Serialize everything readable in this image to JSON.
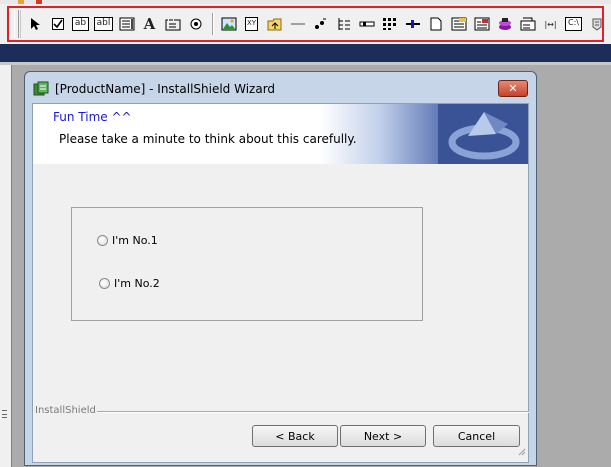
{
  "toolbar": {
    "tools": [
      {
        "id": "select",
        "icon": "arrow-pointer-icon"
      },
      {
        "id": "checkbox",
        "icon": "checkbox-icon"
      },
      {
        "id": "edit",
        "icon": "edit-field-icon",
        "text": "ab"
      },
      {
        "id": "combo",
        "icon": "combo-box-icon",
        "text": "abl"
      },
      {
        "id": "listbox",
        "icon": "list-box-icon"
      },
      {
        "id": "text",
        "icon": "static-text-icon",
        "text": "A"
      },
      {
        "id": "group",
        "icon": "group-box-icon"
      },
      {
        "id": "radio",
        "icon": "radio-group-icon"
      },
      {
        "id": "image",
        "icon": "picture-icon"
      },
      {
        "id": "masked",
        "icon": "masked-edit-icon",
        "text": "XY"
      },
      {
        "id": "folder",
        "icon": "folder-icon"
      },
      {
        "id": "line",
        "icon": "line-icon"
      },
      {
        "id": "progress",
        "icon": "progress-icon"
      },
      {
        "id": "tree",
        "icon": "tree-view-icon"
      },
      {
        "id": "scroll",
        "icon": "scrollbar-icon"
      },
      {
        "id": "dots",
        "icon": "grid-dots-icon"
      },
      {
        "id": "slider",
        "icon": "spin-box-icon"
      },
      {
        "id": "doc",
        "icon": "document-icon"
      },
      {
        "id": "list1",
        "icon": "list-view-icon"
      },
      {
        "id": "list2",
        "icon": "volume-list-icon"
      },
      {
        "id": "billboard",
        "icon": "billboard-icon"
      },
      {
        "id": "dir",
        "icon": "directory-combo-icon"
      },
      {
        "id": "range",
        "icon": "range-icon",
        "text": "|↔|"
      },
      {
        "id": "path",
        "icon": "path-edit-icon",
        "text": "C:\\"
      },
      {
        "id": "help",
        "icon": "hyperlink-icon"
      }
    ]
  },
  "dialog": {
    "title": "[ProductName] - InstallShield Wizard",
    "close_label": "✕",
    "banner_title": "Fun Time ^^",
    "banner_subtitle": "Please take a minute to think about this carefully.",
    "options": [
      {
        "label": "I'm No.1"
      },
      {
        "label": "I'm No.2"
      }
    ],
    "footer_brand": "InstallShield",
    "buttons": {
      "back": "< Back",
      "next": "Next >",
      "cancel": "Cancel"
    }
  },
  "colors": {
    "toolbar_highlight": "#e0202a",
    "navy": "#1d2d5a",
    "banner_title": "#1a1acc"
  }
}
